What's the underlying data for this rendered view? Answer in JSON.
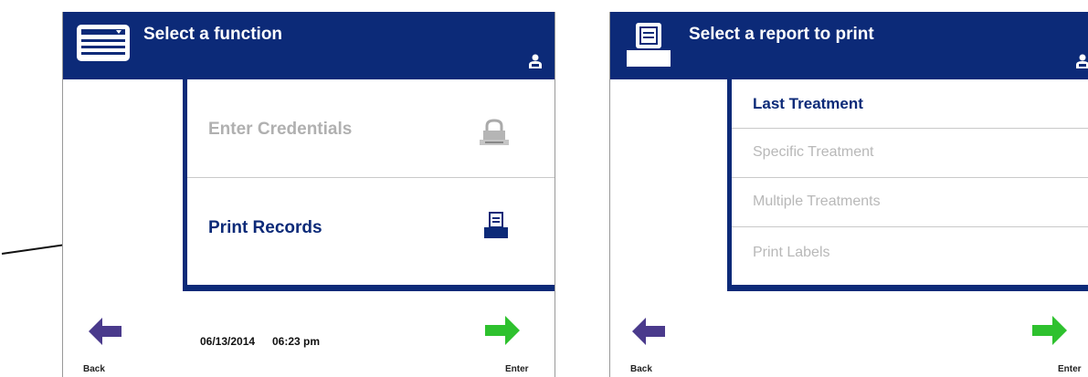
{
  "left_screen": {
    "title": "Select a function",
    "items": [
      {
        "label": "Enter Credentials",
        "enabled": false,
        "icon": "padlock-icon"
      },
      {
        "label": "Print Records",
        "enabled": true,
        "icon": "printer-icon"
      }
    ],
    "footer": {
      "back_label": "Back",
      "date": "06/13/2014",
      "time": "06:23 pm",
      "enter_label": "Enter"
    }
  },
  "right_screen": {
    "title": "Select a report to print",
    "items": [
      {
        "label": "Last Treatment",
        "enabled": true
      },
      {
        "label": "Specific Treatment",
        "enabled": false
      },
      {
        "label": "Multiple Treatments",
        "enabled": false
      },
      {
        "label": "Print Labels",
        "enabled": false
      }
    ],
    "footer": {
      "back_label": "Back",
      "enter_label": "Enter"
    }
  },
  "colors": {
    "header_navy": "#0c2a78",
    "back_arrow": "#4a3a8c",
    "enter_arrow": "#2ec12e",
    "disabled_text": "#b0b0b0",
    "active_text": "#0c2a78"
  }
}
